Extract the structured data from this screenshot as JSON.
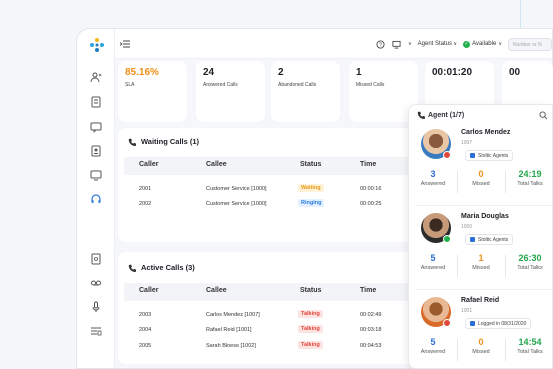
{
  "topbar": {
    "agent_status_label": "Agent Status",
    "availability_label": "Available",
    "number_placeholder": "Number or N"
  },
  "stats": [
    {
      "value": "85.16%",
      "label": "SLA"
    },
    {
      "value": "24",
      "label": "Answered Calls"
    },
    {
      "value": "2",
      "label": "Abandoned Calls"
    },
    {
      "value": "1",
      "label": "Missed Calls"
    },
    {
      "value": "00:01:20",
      "label": ""
    },
    {
      "value": "00",
      "label": ""
    }
  ],
  "waiting": {
    "title": "Waiting Calls (1)",
    "columns": [
      "Caller",
      "Callee",
      "Status",
      "Time"
    ],
    "rows": [
      {
        "caller": "2001",
        "callee": "Customer Service [1000]",
        "status": "Waiting",
        "time": "00:00:16"
      },
      {
        "caller": "2002",
        "callee": "Customer Service [1000]",
        "status": "Ringing",
        "time": "00:00:25"
      }
    ]
  },
  "active": {
    "title": "Active Calls (3)",
    "columns": [
      "Caller",
      "Callee",
      "Status",
      "Time"
    ],
    "rows": [
      {
        "caller": "2003",
        "callee": "Carlos Mendez [1007]",
        "status": "Talking",
        "time": "00:02:49"
      },
      {
        "caller": "2004",
        "callee": "Rafael Reid [1001]",
        "status": "Talking",
        "time": "00:03:18"
      },
      {
        "caller": "2005",
        "callee": "Sarah Bloese [1002]",
        "status": "Talking",
        "time": "00:04:53"
      }
    ]
  },
  "agents": {
    "title": "Agent (1/7)",
    "list": [
      {
        "name": "Carlos Mendez",
        "ext": "1007",
        "group": "Stoltic Agents",
        "answered": "3",
        "missed": "0",
        "total": "24:19",
        "answered_label": "Answered",
        "missed_label": "Missed",
        "total_label": "Total Talks"
      },
      {
        "name": "Maria Douglas",
        "ext": "1006",
        "group": "Stoltic Agents",
        "answered": "5",
        "missed": "1",
        "total": "26:30",
        "answered_label": "Answered",
        "missed_label": "Missed",
        "total_label": "Total Talks"
      },
      {
        "name": "Rafael Reid",
        "ext": "1001",
        "group": "Logged in 08/31/2020",
        "answered": "5",
        "missed": "0",
        "total": "14:54",
        "answered_label": "Answered",
        "missed_label": "Missed",
        "total_label": "Total Talks"
      }
    ]
  },
  "colors": {
    "accent": "#2c7be5",
    "answered": "#2c6fd6",
    "missed": "#f0901a",
    "total": "#23a64b",
    "sla": "#f0901a"
  }
}
